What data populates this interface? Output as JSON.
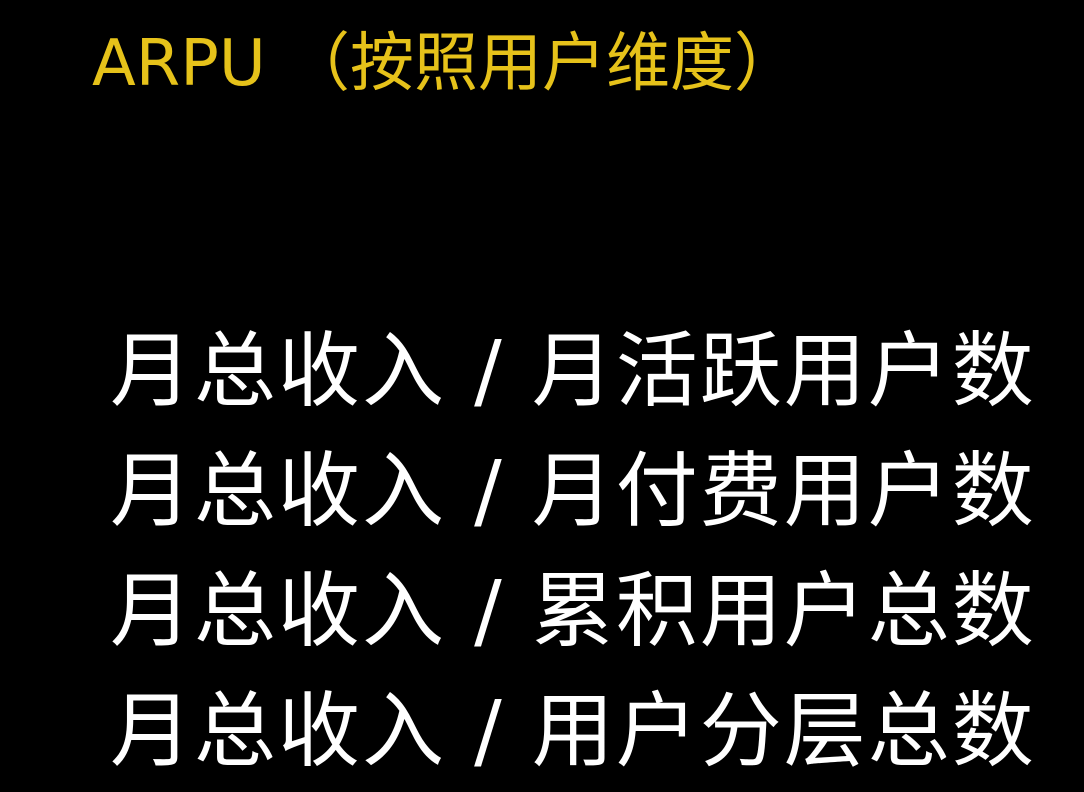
{
  "title": "ARPU （按照用户维度）",
  "colors": {
    "background": "#000000",
    "title": "#e6c21a",
    "text": "#ffffff"
  },
  "formulas": [
    "月总收入 / 月活跃用户数",
    "月总收入 / 月付费用户数",
    "月总收入 / 累积用户总数",
    "月总收入 / 用户分层总数"
  ]
}
